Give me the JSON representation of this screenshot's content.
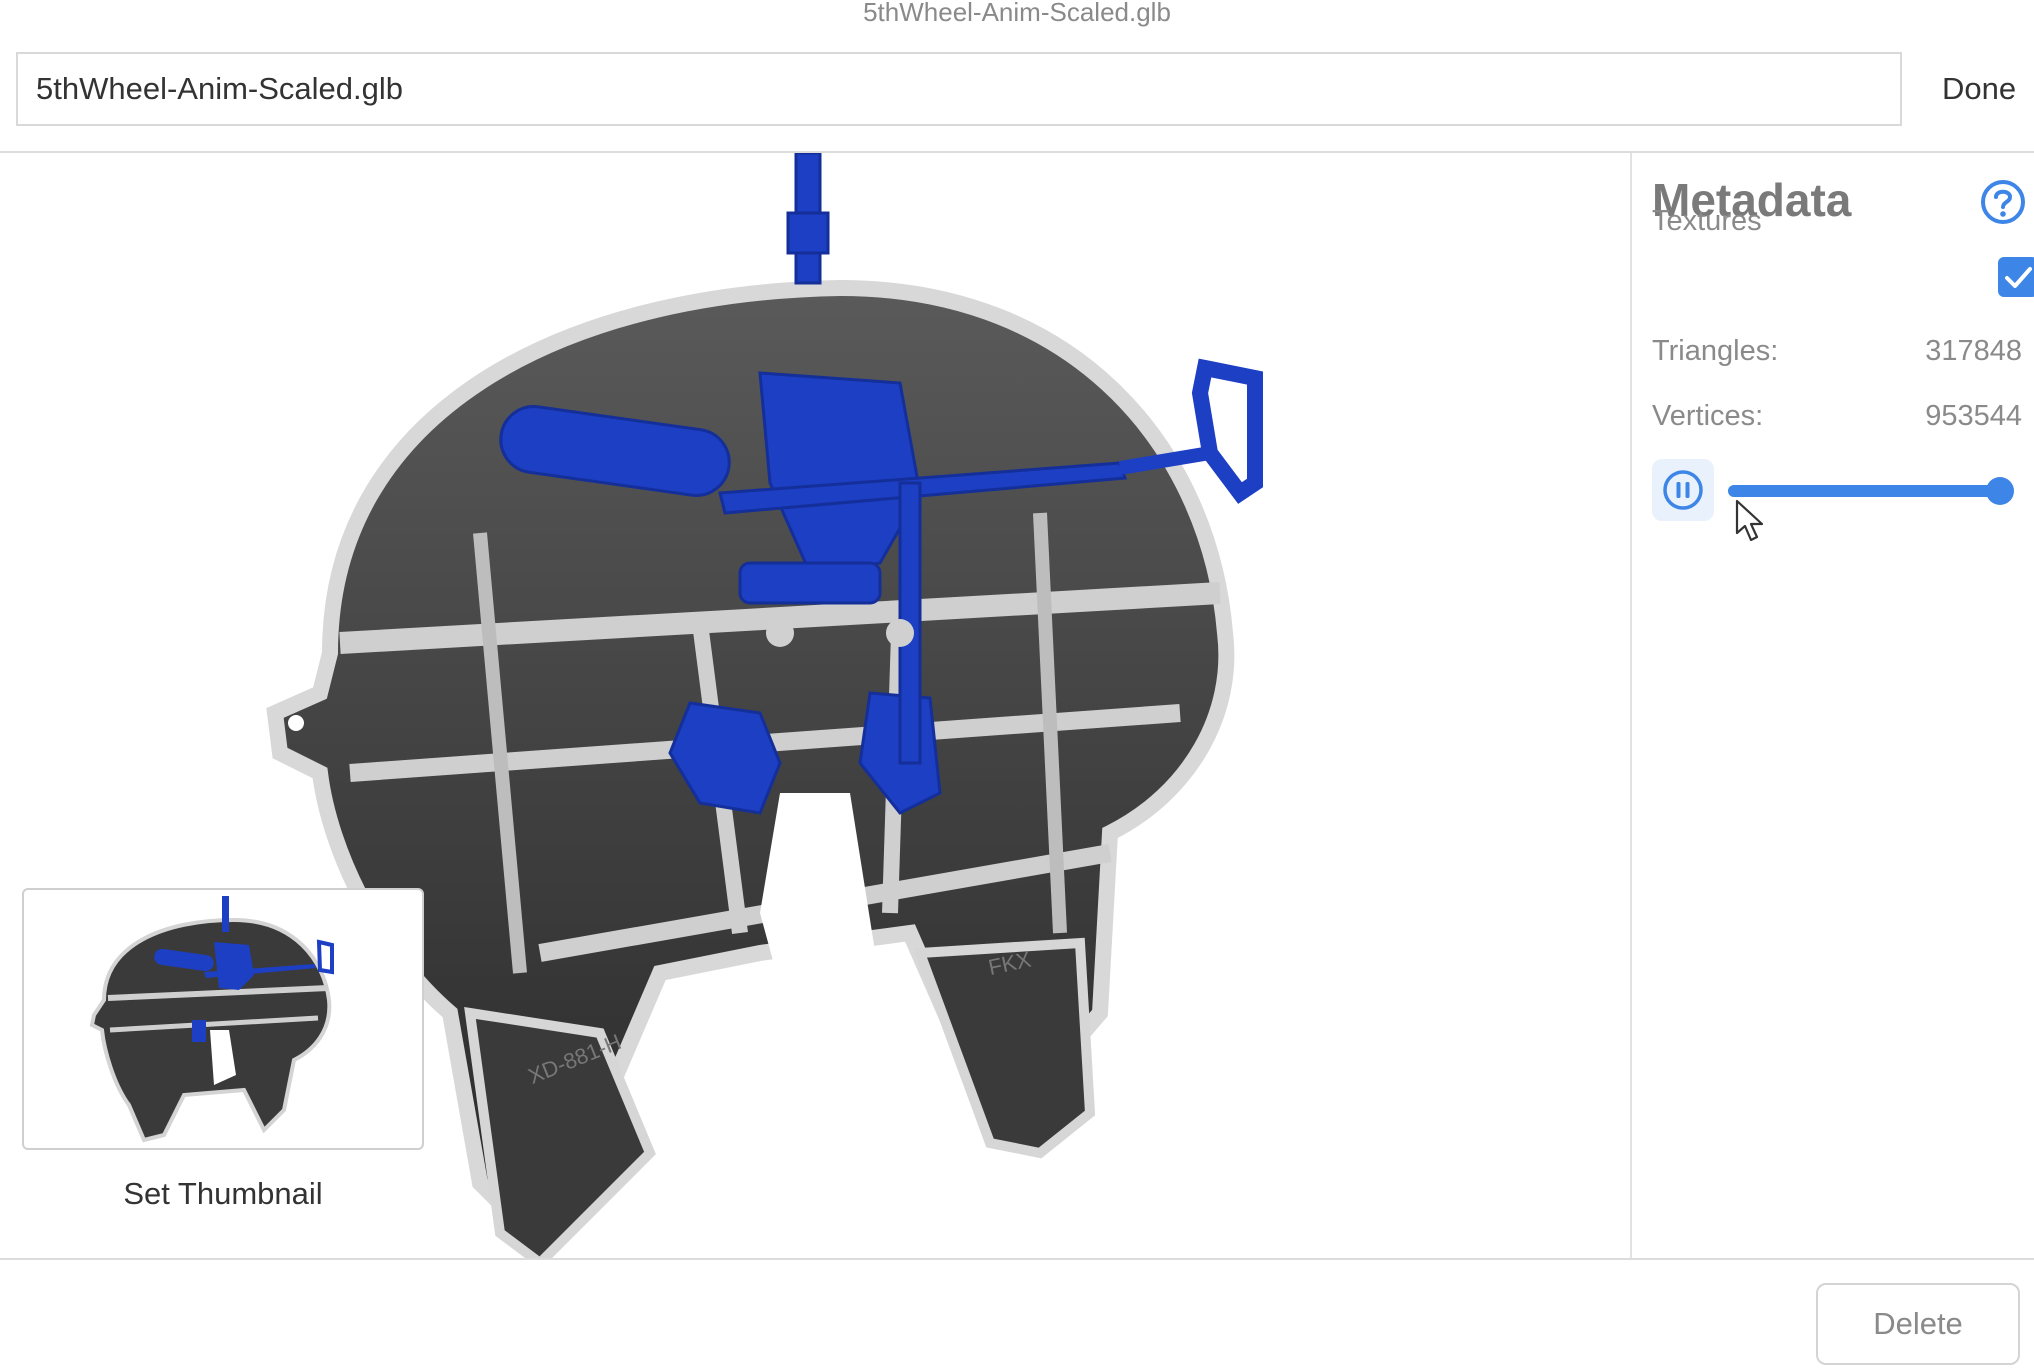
{
  "window": {
    "title": "5thWheel-Anim-Scaled.glb"
  },
  "header": {
    "name_value": "5thWheel-Anim-Scaled.glb",
    "done_label": "Done"
  },
  "viewport": {
    "model_labels": [
      "XD-881-H",
      "FKX"
    ],
    "thumbnail_caption": "Set Thumbnail"
  },
  "metadata": {
    "title": "Metadata",
    "help_icon": "question-circle-icon",
    "textures_label": "Textures",
    "textures_checked": true,
    "triangles_label": "Triangles:",
    "triangles_value": "317848",
    "vertices_label": "Vertices:",
    "vertices_value": "953544",
    "animation": {
      "state_icon": "pause-icon",
      "progress": 0.95
    }
  },
  "footer": {
    "delete_label": "Delete"
  },
  "colors": {
    "accent": "#3d85e6",
    "model_blue": "#1c3fc4",
    "model_metal": "#3a3a3a"
  }
}
